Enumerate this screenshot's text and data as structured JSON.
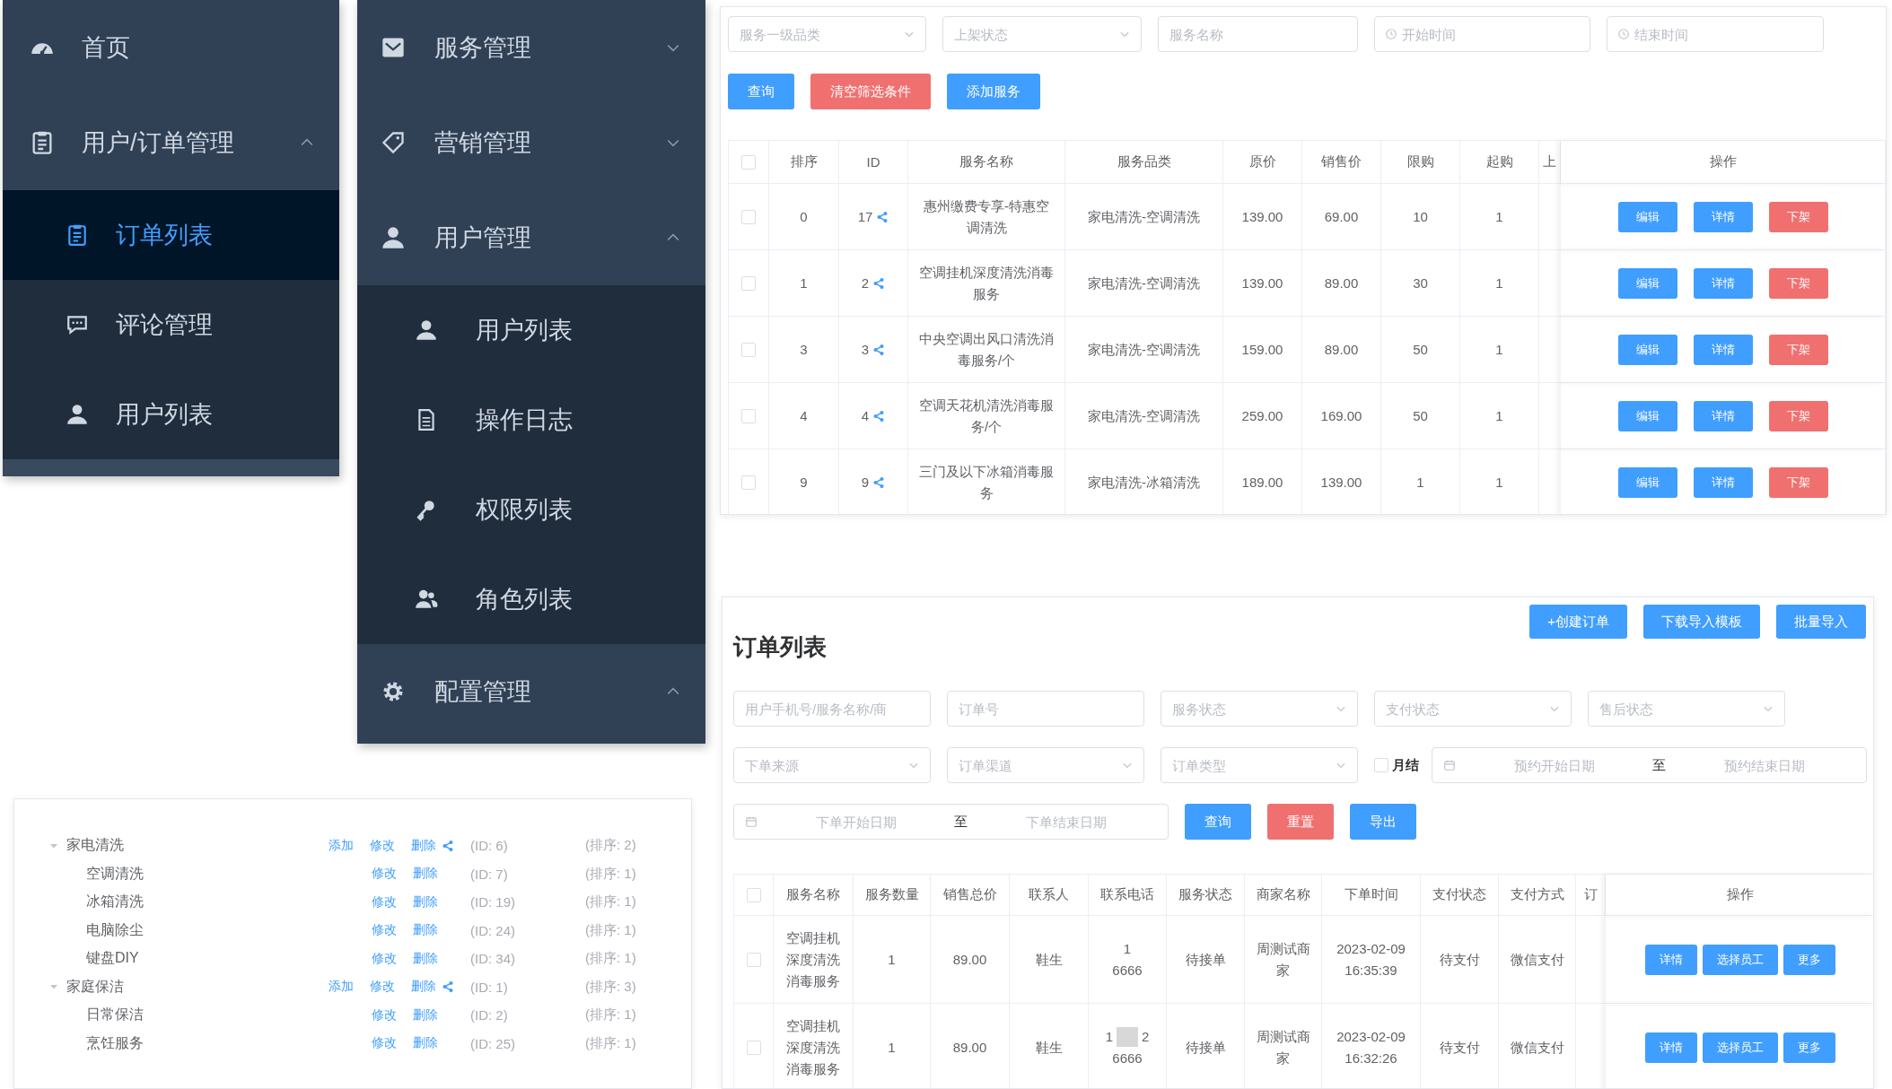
{
  "menu_a": {
    "items": [
      {
        "kind": "link",
        "label": "首页"
      },
      {
        "kind": "submenu",
        "label": "用户/订单管理",
        "expanded": true,
        "children": [
          {
            "label": "订单列表",
            "selected": true
          },
          {
            "label": "评论管理",
            "selected": false
          },
          {
            "label": "用户列表",
            "selected": false
          }
        ]
      }
    ]
  },
  "menu_b": {
    "items": [
      {
        "kind": "submenu",
        "label": "服务管理",
        "expanded": false
      },
      {
        "kind": "submenu",
        "label": "营销管理",
        "expanded": false
      },
      {
        "kind": "submenu",
        "label": "用户管理",
        "expanded": true,
        "children": [
          {
            "label": "用户列表",
            "selected": false
          },
          {
            "label": "操作日志",
            "selected": false
          },
          {
            "label": "权限列表",
            "selected": false
          },
          {
            "label": "角色列表",
            "selected": false
          }
        ]
      },
      {
        "kind": "submenu",
        "label": "配置管理",
        "expanded": true
      }
    ]
  },
  "services": {
    "filters": [
      {
        "kind": "select",
        "placeholder": "服务一级品类"
      },
      {
        "kind": "select",
        "placeholder": "上架状态"
      },
      {
        "kind": "text",
        "placeholder": "服务名称"
      },
      {
        "kind": "time",
        "placeholder": "开始时间"
      },
      {
        "kind": "time",
        "placeholder": "结束时间"
      }
    ],
    "buttons": [
      {
        "kind": "primary",
        "label": "查询"
      },
      {
        "kind": "danger",
        "label": "清空筛选条件"
      },
      {
        "kind": "primary",
        "label": "添加服务"
      }
    ],
    "table": {
      "all_checked": false,
      "columns": [
        "排序",
        "ID",
        "服务名称",
        "服务品类",
        "原价",
        "销售价",
        "限购",
        "起购",
        "上",
        "操作"
      ],
      "rows": [
        {
          "checked": false,
          "cells": [
            "0",
            "17",
            "惠州缴费专享-特惠空调清洗",
            "家电清洗-空调清洗",
            "139.00",
            "69.00",
            "10",
            "1"
          ],
          "actions": [
            {
              "kind": "primary",
              "label": "编辑"
            },
            {
              "kind": "primary",
              "label": "详情"
            },
            {
              "kind": "danger",
              "label": "下架"
            }
          ]
        },
        {
          "checked": false,
          "cells": [
            "1",
            "2",
            "空调挂机深度清洗消毒服务",
            "家电清洗-空调清洗",
            "139.00",
            "89.00",
            "30",
            "1"
          ],
          "actions": [
            {
              "kind": "primary",
              "label": "编辑"
            },
            {
              "kind": "primary",
              "label": "详情"
            },
            {
              "kind": "danger",
              "label": "下架"
            }
          ]
        },
        {
          "checked": false,
          "cells": [
            "3",
            "3",
            "中央空调出风口清洗消毒服务/个",
            "家电清洗-空调清洗",
            "159.00",
            "89.00",
            "50",
            "1"
          ],
          "actions": [
            {
              "kind": "primary",
              "label": "编辑"
            },
            {
              "kind": "primary",
              "label": "详情"
            },
            {
              "kind": "danger",
              "label": "下架"
            }
          ]
        },
        {
          "checked": false,
          "cells": [
            "4",
            "4",
            "空调天花机清洗消毒服务/个",
            "家电清洗-空调清洗",
            "259.00",
            "169.00",
            "50",
            "1"
          ],
          "actions": [
            {
              "kind": "primary",
              "label": "编辑"
            },
            {
              "kind": "primary",
              "label": "详情"
            },
            {
              "kind": "danger",
              "label": "下架"
            }
          ]
        },
        {
          "checked": false,
          "cells": [
            "9",
            "9",
            "三门及以下冰箱消毒服务",
            "家电清洗-冰箱清洗",
            "189.00",
            "139.00",
            "1",
            "1"
          ],
          "actions": [
            {
              "kind": "primary",
              "label": "编辑"
            },
            {
              "kind": "primary",
              "label": "详情"
            },
            {
              "kind": "danger",
              "label": "下架"
            }
          ]
        }
      ]
    }
  },
  "orders": {
    "title": "订单列表",
    "header_buttons": [
      "+创建订单",
      "下载导入模板",
      "批量导入"
    ],
    "filter_rows": [
      [
        {
          "kind": "text",
          "placeholder": "用户手机号/服务名称/商"
        },
        {
          "kind": "text",
          "placeholder": "订单号"
        },
        {
          "kind": "select",
          "placeholder": "服务状态"
        },
        {
          "kind": "select",
          "placeholder": "支付状态"
        },
        {
          "kind": "select",
          "placeholder": "售后状态"
        }
      ],
      [
        {
          "kind": "select",
          "placeholder": "下单来源"
        },
        {
          "kind": "select",
          "placeholder": "订单渠道"
        },
        {
          "kind": "select",
          "placeholder": "订单类型"
        },
        {
          "kind": "checkbox",
          "label": "月结",
          "checked": false
        },
        {
          "kind": "daterange",
          "start": {
            "placeholder": "预约开始日期"
          },
          "separator": "至",
          "end": {
            "placeholder": "预约结束日期"
          }
        }
      ],
      [
        {
          "kind": "daterange",
          "start": {
            "placeholder": "下单开始日期"
          },
          "separator": "至",
          "end": {
            "placeholder": "下单结束日期"
          }
        },
        {
          "kind": "primary",
          "label": "查询"
        },
        {
          "kind": "danger",
          "label": "重置"
        },
        {
          "kind": "primary",
          "label": "导出"
        }
      ]
    ],
    "table": {
      "all_checked": false,
      "columns": [
        "服务名称",
        "服务数量",
        "销售总价",
        "联系人",
        "联系电话",
        "服务状态",
        "商家名称",
        "下单时间",
        "支付状态",
        "支付方式",
        "订",
        "操作"
      ],
      "rows": [
        {
          "checked": false,
          "service": "空调挂机深度清洗消毒服务",
          "quantity": "1",
          "total": "89.00",
          "contact": "鞋生",
          "phone_first": [
            "1"
          ],
          "phone_second": "6666",
          "status": "待接单",
          "merchant": "周测试商家",
          "date": "2023-02-09",
          "time": "16:35:39",
          "pay_status": "待支付",
          "pay_method": "微信支付",
          "actions": [
            "详情",
            "选择员工",
            "更多"
          ]
        },
        {
          "checked": false,
          "service": "空调挂机深度清洗消毒服务",
          "quantity": "1",
          "total": "89.00",
          "contact": "鞋生",
          "phone_first": [
            "1",
            "2"
          ],
          "phone_second": "6666",
          "status": "待接单",
          "merchant": "周测试商家",
          "date": "2023-02-09",
          "time": "16:32:26",
          "pay_status": "待支付",
          "pay_method": "微信支付",
          "actions": [
            "详情",
            "选择员工",
            "更多"
          ]
        }
      ]
    }
  },
  "category_tree": {
    "nodes": [
      {
        "label": "家电清洗",
        "expanded": true,
        "actions": [
          "添加",
          "修改",
          "删除"
        ],
        "id": "(ID: 6)",
        "sort": "(排序: 2)",
        "children": [
          {
            "label": "空调清洗",
            "actions": [
              "修改",
              "删除"
            ],
            "id": "(ID: 7)",
            "sort": "(排序: 1)"
          },
          {
            "label": "冰箱清洗",
            "actions": [
              "修改",
              "删除"
            ],
            "id": "(ID: 19)",
            "sort": "(排序: 1)"
          },
          {
            "label": "电脑除尘",
            "actions": [
              "修改",
              "删除"
            ],
            "id": "(ID: 24)",
            "sort": "(排序: 1)"
          },
          {
            "label": "键盘DIY",
            "actions": [
              "修改",
              "删除"
            ],
            "id": "(ID: 34)",
            "sort": "(排序: 1)"
          }
        ]
      },
      {
        "label": "家庭保洁",
        "expanded": true,
        "actions": [
          "添加",
          "修改",
          "删除"
        ],
        "id": "(ID: 1)",
        "sort": "(排序: 3)",
        "children": [
          {
            "label": "日常保洁",
            "actions": [
              "修改",
              "删除"
            ],
            "id": "(ID: 2)",
            "sort": "(排序: 1)"
          },
          {
            "label": "烹饪服务",
            "actions": [
              "修改",
              "删除"
            ],
            "id": "(ID: 25)",
            "sort": "(排序: 1)"
          }
        ]
      }
    ]
  }
}
